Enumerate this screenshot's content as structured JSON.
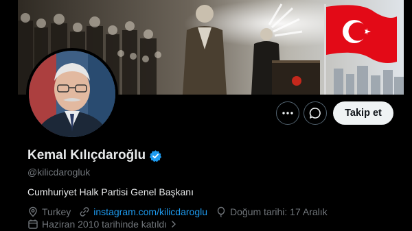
{
  "profile": {
    "display_name": "Kemal Kılıçdaroğlu",
    "handle": "@kilicdarogluk",
    "bio": "Cumhuriyet Halk Partisi Genel Başkanı",
    "location": "Turkey",
    "website": "instagram.com/kilicdaroglu",
    "birthday": "Doğum tarihi: 17 Aralık",
    "joined": "Haziran 2010 tarihinde katıldı",
    "verified_icon": "verified-badge-icon"
  },
  "actions": {
    "follow_label": "Takip et",
    "more_icon": "more-icon",
    "message_icon": "message-icon"
  },
  "colors": {
    "background": "#000000",
    "text_primary": "#e7e9ea",
    "text_secondary": "#71767b",
    "link": "#1d9bf0",
    "follow_bg": "#eff3f4",
    "verified": "#1d9bf0",
    "flag_red": "#e30a17"
  }
}
